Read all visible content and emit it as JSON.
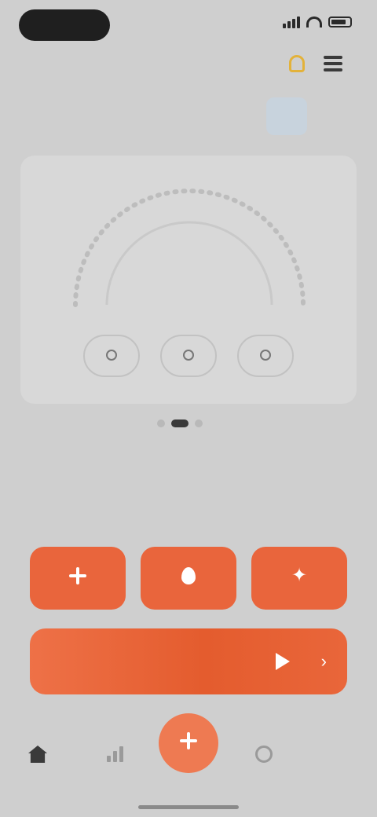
{
  "status": {
    "time": ""
  },
  "header": {
    "title": ""
  },
  "days": [
    {
      "name": "",
      "num": ""
    },
    {
      "name": "",
      "num": ""
    },
    {
      "name": "",
      "num": ""
    },
    {
      "name": "",
      "num": ""
    },
    {
      "name": "",
      "num": ""
    },
    {
      "name": "",
      "num": "",
      "active": true
    },
    {
      "name": "",
      "num": ""
    }
  ],
  "gauge": {
    "value": "",
    "subtitle": ""
  },
  "metrics": [
    {
      "label": ""
    },
    {
      "label": ""
    },
    {
      "label": ""
    }
  ],
  "section": {
    "label": ""
  },
  "actions": [
    {
      "label": "",
      "icon": "plus-icon"
    },
    {
      "label": "",
      "icon": "drop-icon"
    },
    {
      "label": "",
      "icon": "star-icon"
    }
  ],
  "wide_action": {
    "title": "",
    "subtitle": "",
    "icon": "play-icon"
  },
  "colors": {
    "accent": "#e9653c",
    "brand_text": "#e35a2b",
    "background": "#cfcfcf",
    "card": "#d8d8d8",
    "notice": "#e3b23a"
  }
}
